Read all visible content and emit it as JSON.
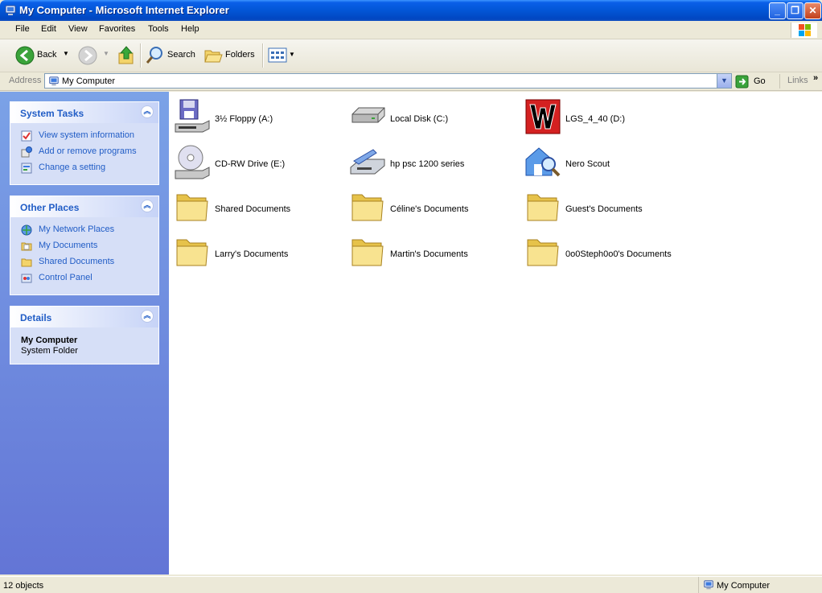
{
  "window": {
    "title": "My Computer - Microsoft Internet Explorer"
  },
  "menu": [
    "File",
    "Edit",
    "View",
    "Favorites",
    "Tools",
    "Help"
  ],
  "toolbar": {
    "back": "Back",
    "search": "Search",
    "folders": "Folders"
  },
  "address": {
    "label": "Address",
    "value": "My Computer",
    "go": "Go",
    "links": "Links"
  },
  "system_tasks": {
    "title": "System Tasks",
    "items": [
      "View system information",
      "Add or remove programs",
      "Change a setting"
    ]
  },
  "other_places": {
    "title": "Other Places",
    "items": [
      "My Network Places",
      "My Documents",
      "Shared Documents",
      "Control Panel"
    ]
  },
  "details": {
    "title": "Details",
    "name": "My Computer",
    "type": "System Folder"
  },
  "items": [
    {
      "label": "3½ Floppy (A:)",
      "icon": "floppy-drive-icon"
    },
    {
      "label": "Local Disk (C:)",
      "icon": "hard-disk-icon"
    },
    {
      "label": "LGS_4_40 (D:)",
      "icon": "custom-w-drive-icon"
    },
    {
      "label": "CD-RW Drive (E:)",
      "icon": "cd-drive-icon"
    },
    {
      "label": "hp psc 1200 series",
      "icon": "scanner-icon"
    },
    {
      "label": "Nero Scout",
      "icon": "nero-scout-icon"
    },
    {
      "label": "Shared Documents",
      "icon": "folder-icon"
    },
    {
      "label": "Céline's Documents",
      "icon": "folder-icon"
    },
    {
      "label": "Guest's Documents",
      "icon": "folder-icon"
    },
    {
      "label": "Larry's Documents",
      "icon": "folder-icon"
    },
    {
      "label": "Martin's Documents",
      "icon": "folder-icon"
    },
    {
      "label": "0o0Steph0o0's Documents",
      "icon": "folder-icon"
    }
  ],
  "status": {
    "count": "12 objects",
    "zone": "My Computer"
  }
}
